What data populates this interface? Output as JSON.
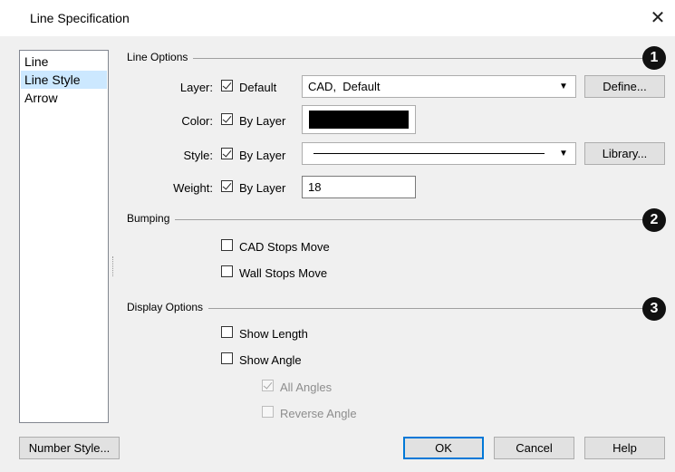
{
  "window": {
    "title": "Line Specification",
    "close_glyph": "✕"
  },
  "sidebar": {
    "items": [
      {
        "label": "Line",
        "selected": false
      },
      {
        "label": "Line Style",
        "selected": true
      },
      {
        "label": "Arrow",
        "selected": false
      }
    ]
  },
  "line_options": {
    "section_label": "Line Options",
    "badge": "1",
    "layer": {
      "label": "Layer:",
      "checkbox_label": "Default",
      "checked": true,
      "value": "CAD,  Default",
      "define_button": "Define..."
    },
    "color": {
      "label": "Color:",
      "checkbox_label": "By Layer",
      "checked": true,
      "swatch_color": "#000000"
    },
    "style": {
      "label": "Style:",
      "checkbox_label": "By Layer",
      "checked": true,
      "library_button": "Library..."
    },
    "weight": {
      "label": "Weight:",
      "checkbox_label": "By Layer",
      "checked": true,
      "value": "18"
    }
  },
  "bumping": {
    "section_label": "Bumping",
    "badge": "2",
    "cad_stops_move": {
      "label": "CAD Stops Move",
      "checked": false
    },
    "wall_stops_move": {
      "label": "Wall Stops Move",
      "checked": false
    }
  },
  "display_options": {
    "section_label": "Display Options",
    "badge": "3",
    "show_length": {
      "label": "Show Length",
      "checked": false
    },
    "show_angle": {
      "label": "Show Angle",
      "checked": false
    },
    "all_angles": {
      "label": "All Angles",
      "checked": true,
      "disabled": true
    },
    "reverse_angle": {
      "label": "Reverse Angle",
      "checked": false,
      "disabled": true
    }
  },
  "footer": {
    "number_style": "Number Style...",
    "ok": "OK",
    "cancel": "Cancel",
    "help": "Help"
  },
  "icons": {
    "close": "close-icon",
    "dropdown": "chevron-down-icon",
    "dropdown_glyph": "▼"
  },
  "colors": {
    "selection": "#cce8ff",
    "accent": "#0078d7"
  }
}
